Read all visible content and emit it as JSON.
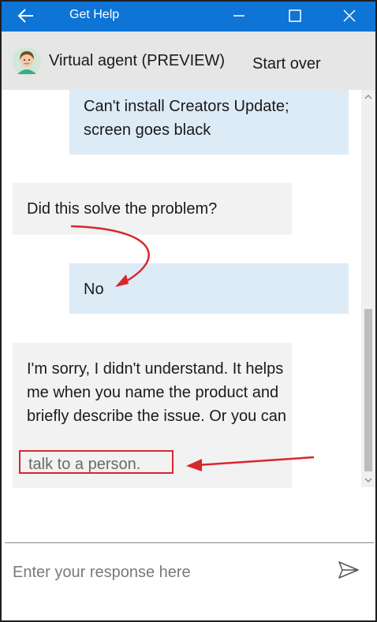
{
  "window": {
    "title": "Get Help"
  },
  "agent": {
    "name": "Virtual agent (PREVIEW)",
    "start_over": "Start over"
  },
  "messages": [
    {
      "from": "user",
      "text": "Can't install Creators Update; screen goes black"
    },
    {
      "from": "bot",
      "text": "Did this solve the problem?"
    },
    {
      "from": "user",
      "text": "No"
    },
    {
      "from": "bot",
      "text": "I'm sorry, I didn't understand. It helps me when you name the product and briefly describe the issue. Or you can",
      "link": "talk to a person."
    }
  ],
  "input": {
    "placeholder": "Enter your response here",
    "value": ""
  },
  "colors": {
    "titlebar": "#0e74d6",
    "header": "#e6e6e6",
    "user_bubble": "#ddebf7",
    "bot_bubble": "#f2f2f2",
    "annotation": "#d9262c"
  },
  "icons": {
    "back": "back-arrow-icon",
    "minimize": "minimize-icon",
    "maximize": "maximize-icon",
    "close": "close-icon",
    "avatar": "agent-avatar",
    "send": "send-icon"
  }
}
